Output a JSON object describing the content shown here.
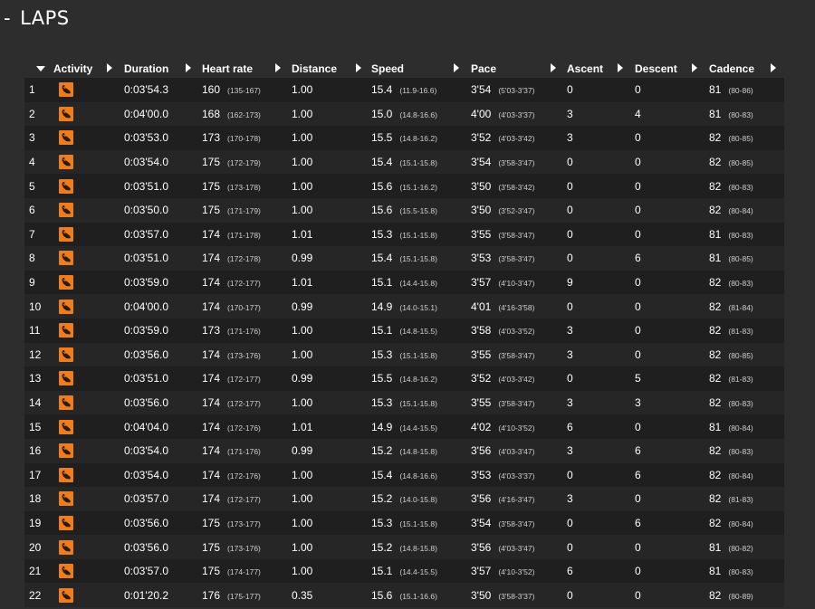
{
  "header": {
    "toggle": "-",
    "title": "LAPS"
  },
  "columns": [
    "Activity",
    "Duration",
    "Heart rate",
    "Distance",
    "Speed",
    "Pace",
    "Ascent",
    "Descent",
    "Cadence"
  ],
  "laps": [
    {
      "lap": "1",
      "duration": "0:03'54.3",
      "hr": "160",
      "hr_range": "(135-167)",
      "distance": "1.00",
      "speed": "15.4",
      "speed_range": "(11.9-16.6)",
      "pace": "3'54",
      "pace_range": "(5'03-3'37)",
      "ascent": "0",
      "descent": "0",
      "cadence": "81",
      "cadence_range": "(80-86)"
    },
    {
      "lap": "2",
      "duration": "0:04'00.0",
      "hr": "168",
      "hr_range": "(162-173)",
      "distance": "1.00",
      "speed": "15.0",
      "speed_range": "(14.8-16.6)",
      "pace": "4'00",
      "pace_range": "(4'03-3'37)",
      "ascent": "3",
      "descent": "4",
      "cadence": "81",
      "cadence_range": "(80-83)"
    },
    {
      "lap": "3",
      "duration": "0:03'53.0",
      "hr": "173",
      "hr_range": "(170-178)",
      "distance": "1.00",
      "speed": "15.5",
      "speed_range": "(14.8-16.2)",
      "pace": "3'52",
      "pace_range": "(4'03-3'42)",
      "ascent": "3",
      "descent": "0",
      "cadence": "82",
      "cadence_range": "(80-85)"
    },
    {
      "lap": "4",
      "duration": "0:03'54.0",
      "hr": "175",
      "hr_range": "(172-179)",
      "distance": "1.00",
      "speed": "15.4",
      "speed_range": "(15.1-15.8)",
      "pace": "3'54",
      "pace_range": "(3'58-3'47)",
      "ascent": "0",
      "descent": "0",
      "cadence": "82",
      "cadence_range": "(80-85)"
    },
    {
      "lap": "5",
      "duration": "0:03'51.0",
      "hr": "175",
      "hr_range": "(173-178)",
      "distance": "1.00",
      "speed": "15.6",
      "speed_range": "(15.1-16.2)",
      "pace": "3'50",
      "pace_range": "(3'58-3'42)",
      "ascent": "0",
      "descent": "0",
      "cadence": "82",
      "cadence_range": "(80-83)"
    },
    {
      "lap": "6",
      "duration": "0:03'50.0",
      "hr": "175",
      "hr_range": "(171-179)",
      "distance": "1.00",
      "speed": "15.6",
      "speed_range": "(15.5-15.8)",
      "pace": "3'50",
      "pace_range": "(3'52-3'47)",
      "ascent": "0",
      "descent": "0",
      "cadence": "82",
      "cadence_range": "(80-84)"
    },
    {
      "lap": "7",
      "duration": "0:03'57.0",
      "hr": "174",
      "hr_range": "(171-178)",
      "distance": "1.01",
      "speed": "15.3",
      "speed_range": "(15.1-15.8)",
      "pace": "3'55",
      "pace_range": "(3'58-3'47)",
      "ascent": "0",
      "descent": "0",
      "cadence": "81",
      "cadence_range": "(80-83)"
    },
    {
      "lap": "8",
      "duration": "0:03'51.0",
      "hr": "174",
      "hr_range": "(172-178)",
      "distance": "0.99",
      "speed": "15.4",
      "speed_range": "(15.1-15.8)",
      "pace": "3'53",
      "pace_range": "(3'58-3'47)",
      "ascent": "0",
      "descent": "6",
      "cadence": "81",
      "cadence_range": "(80-85)"
    },
    {
      "lap": "9",
      "duration": "0:03'59.0",
      "hr": "174",
      "hr_range": "(172-177)",
      "distance": "1.01",
      "speed": "15.1",
      "speed_range": "(14.4-15.8)",
      "pace": "3'57",
      "pace_range": "(4'10-3'47)",
      "ascent": "9",
      "descent": "0",
      "cadence": "82",
      "cadence_range": "(80-83)"
    },
    {
      "lap": "10",
      "duration": "0:04'00.0",
      "hr": "174",
      "hr_range": "(170-177)",
      "distance": "0.99",
      "speed": "14.9",
      "speed_range": "(14.0-15.1)",
      "pace": "4'01",
      "pace_range": "(4'16-3'58)",
      "ascent": "0",
      "descent": "0",
      "cadence": "82",
      "cadence_range": "(81-84)"
    },
    {
      "lap": "11",
      "duration": "0:03'59.0",
      "hr": "173",
      "hr_range": "(171-176)",
      "distance": "1.00",
      "speed": "15.1",
      "speed_range": "(14.8-15.5)",
      "pace": "3'58",
      "pace_range": "(4'03-3'52)",
      "ascent": "3",
      "descent": "0",
      "cadence": "82",
      "cadence_range": "(81-83)"
    },
    {
      "lap": "12",
      "duration": "0:03'56.0",
      "hr": "174",
      "hr_range": "(173-176)",
      "distance": "1.00",
      "speed": "15.3",
      "speed_range": "(15.1-15.8)",
      "pace": "3'55",
      "pace_range": "(3'58-3'47)",
      "ascent": "3",
      "descent": "0",
      "cadence": "82",
      "cadence_range": "(80-85)"
    },
    {
      "lap": "13",
      "duration": "0:03'51.0",
      "hr": "174",
      "hr_range": "(172-177)",
      "distance": "0.99",
      "speed": "15.5",
      "speed_range": "(14.8-16.2)",
      "pace": "3'52",
      "pace_range": "(4'03-3'42)",
      "ascent": "0",
      "descent": "5",
      "cadence": "82",
      "cadence_range": "(81-83)"
    },
    {
      "lap": "14",
      "duration": "0:03'56.0",
      "hr": "174",
      "hr_range": "(172-177)",
      "distance": "1.00",
      "speed": "15.3",
      "speed_range": "(15.1-15.8)",
      "pace": "3'55",
      "pace_range": "(3'58-3'47)",
      "ascent": "3",
      "descent": "3",
      "cadence": "82",
      "cadence_range": "(80-83)"
    },
    {
      "lap": "15",
      "duration": "0:04'04.0",
      "hr": "174",
      "hr_range": "(172-176)",
      "distance": "1.01",
      "speed": "14.9",
      "speed_range": "(14.4-15.5)",
      "pace": "4'02",
      "pace_range": "(4'10-3'52)",
      "ascent": "6",
      "descent": "0",
      "cadence": "81",
      "cadence_range": "(80-84)"
    },
    {
      "lap": "16",
      "duration": "0:03'54.0",
      "hr": "174",
      "hr_range": "(171-176)",
      "distance": "0.99",
      "speed": "15.2",
      "speed_range": "(14.8-15.8)",
      "pace": "3'56",
      "pace_range": "(4'03-3'47)",
      "ascent": "3",
      "descent": "6",
      "cadence": "82",
      "cadence_range": "(80-83)"
    },
    {
      "lap": "17",
      "duration": "0:03'54.0",
      "hr": "174",
      "hr_range": "(172-176)",
      "distance": "1.00",
      "speed": "15.4",
      "speed_range": "(14.8-16.6)",
      "pace": "3'53",
      "pace_range": "(4'03-3'37)",
      "ascent": "0",
      "descent": "6",
      "cadence": "82",
      "cadence_range": "(80-84)"
    },
    {
      "lap": "18",
      "duration": "0:03'57.0",
      "hr": "174",
      "hr_range": "(172-177)",
      "distance": "1.00",
      "speed": "15.2",
      "speed_range": "(14.0-15.8)",
      "pace": "3'56",
      "pace_range": "(4'16-3'47)",
      "ascent": "3",
      "descent": "0",
      "cadence": "82",
      "cadence_range": "(81-83)"
    },
    {
      "lap": "19",
      "duration": "0:03'56.0",
      "hr": "175",
      "hr_range": "(173-177)",
      "distance": "1.00",
      "speed": "15.3",
      "speed_range": "(15.1-15.8)",
      "pace": "3'54",
      "pace_range": "(3'58-3'47)",
      "ascent": "0",
      "descent": "6",
      "cadence": "82",
      "cadence_range": "(80-84)"
    },
    {
      "lap": "20",
      "duration": "0:03'56.0",
      "hr": "175",
      "hr_range": "(173-176)",
      "distance": "1.00",
      "speed": "15.2",
      "speed_range": "(14.8-15.8)",
      "pace": "3'56",
      "pace_range": "(4'03-3'47)",
      "ascent": "0",
      "descent": "0",
      "cadence": "81",
      "cadence_range": "(80-82)"
    },
    {
      "lap": "21",
      "duration": "0:03'57.0",
      "hr": "175",
      "hr_range": "(174-177)",
      "distance": "1.00",
      "speed": "15.1",
      "speed_range": "(14.4-15.5)",
      "pace": "3'57",
      "pace_range": "(4'10-3'52)",
      "ascent": "6",
      "descent": "0",
      "cadence": "81",
      "cadence_range": "(80-83)"
    },
    {
      "lap": "22",
      "duration": "0:01'20.2",
      "hr": "176",
      "hr_range": "(175-177)",
      "distance": "0.35",
      "speed": "15.6",
      "speed_range": "(15.1-16.6)",
      "pace": "3'50",
      "pace_range": "(3'58-3'37)",
      "ascent": "0",
      "descent": "0",
      "cadence": "82",
      "cadence_range": "(80-89)"
    }
  ],
  "activity_icon": "running-shoe-icon",
  "colors": {
    "background": "#2d2d2d",
    "row_odd": "#1f1f1f",
    "row_even": "#262626",
    "activity_accent": "#f07d1c"
  }
}
